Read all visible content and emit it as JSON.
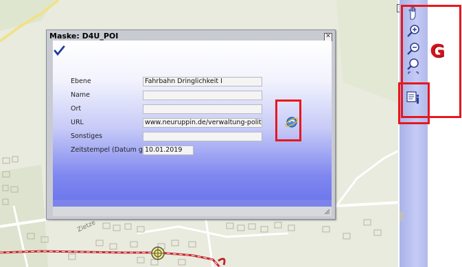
{
  "dialog": {
    "title": "Maske: D4U_POI",
    "close_glyph": "✕",
    "fields": [
      {
        "label": "Ebene",
        "value": "Fahrbahn Dringlichkeit I"
      },
      {
        "label": "Name",
        "value": ""
      },
      {
        "label": "Ort",
        "value": ""
      },
      {
        "label": "URL",
        "value": "www.neuruppin.de/verwaltung-politik/buer"
      },
      {
        "label": "Sonstiges",
        "value": ""
      },
      {
        "label": "Zeitstempel (Datum ge",
        "value": "10.01.2019"
      }
    ]
  },
  "map": {
    "street_label": "Zietze"
  },
  "toolbar": {
    "tools": [
      "pan-hand-icon",
      "zoom-in-icon",
      "zoom-out-icon",
      "zoom-extent-icon",
      "info-identify-icon"
    ]
  },
  "annotation": {
    "letter": "G",
    "color": "#e8161c"
  },
  "colors": {
    "toolbar_bg": "#b9c0f0",
    "dialog_gradient_end": "#6f78ec",
    "route_line": "#c4232a"
  }
}
